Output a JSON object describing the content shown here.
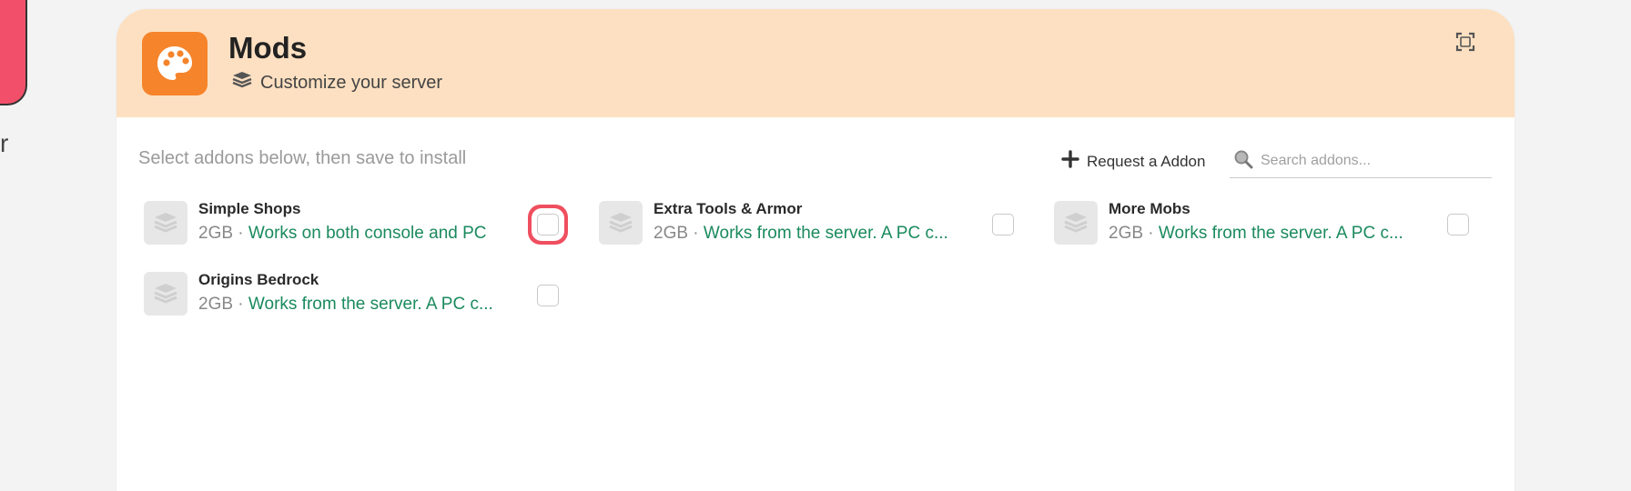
{
  "background": {
    "side_text": "r"
  },
  "panel": {
    "title": "Mods",
    "subtitle": "Customize your server",
    "header_icon": "palette-icon",
    "subtitle_icon": "layers-icon",
    "expand_icon": "expand-icon",
    "colors": {
      "header_bg": "#fde0c1",
      "icon_bg": "#f5842b",
      "desc_green": "#1a8a5e",
      "highlight_red": "#ef4f5f"
    }
  },
  "toolbar": {
    "hint": "Select addons below, then save to install",
    "request_label": "Request a Addon",
    "search_placeholder": "Search addons..."
  },
  "addons": [
    {
      "name": "Simple Shops",
      "size": "2GB",
      "desc": "Works on both console and PC",
      "checked": false
    },
    {
      "name": "Extra Tools & Armor",
      "size": "2GB",
      "desc": "Works from the server. A PC c...",
      "checked": false
    },
    {
      "name": "More Mobs",
      "size": "2GB",
      "desc": "Works from the server. A PC c...",
      "checked": false
    },
    {
      "name": "Origins Bedrock",
      "size": "2GB",
      "desc": "Works from the server. A PC c...",
      "checked": false
    }
  ],
  "separator": " · "
}
